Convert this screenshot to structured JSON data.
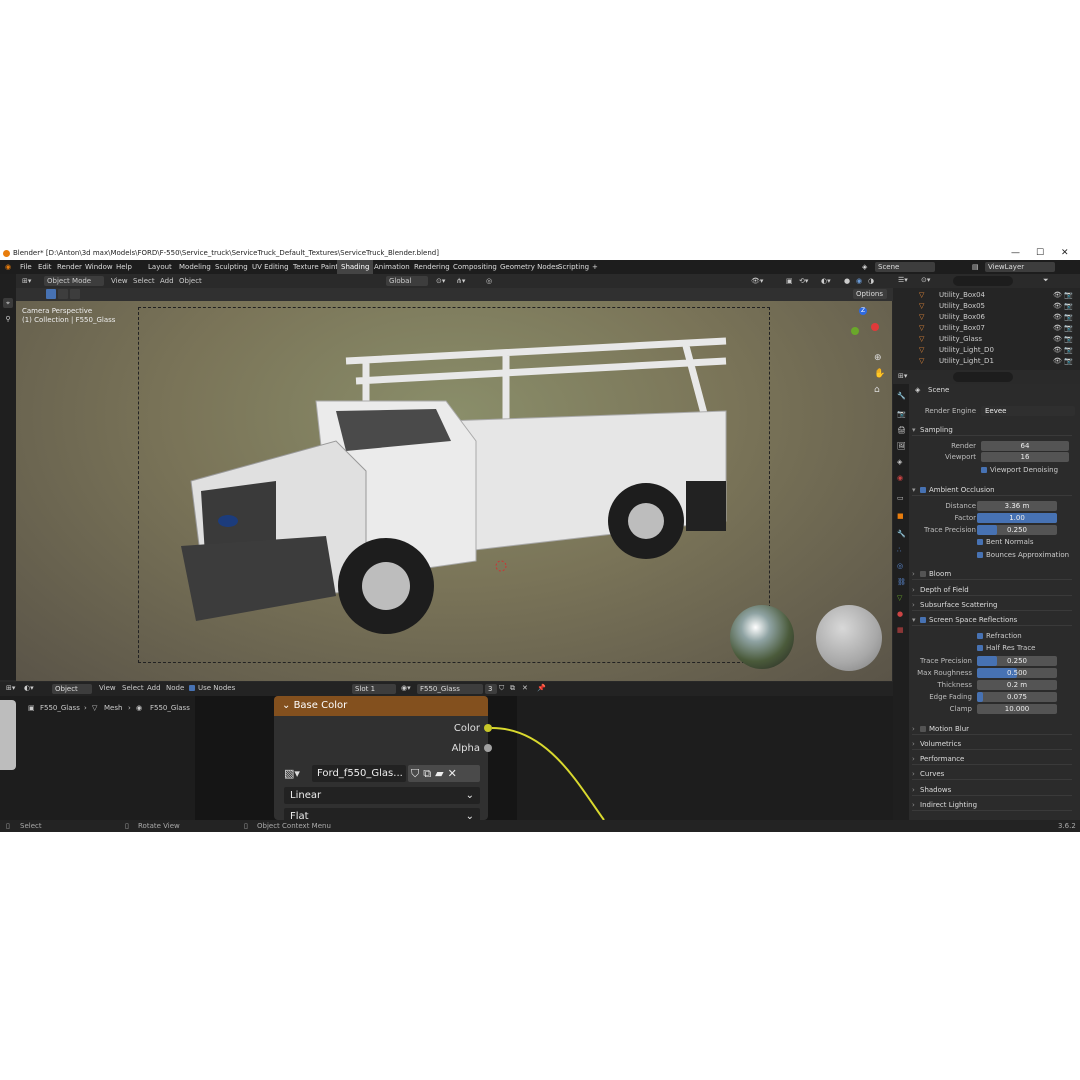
{
  "window": {
    "title": "Blender* [D:\\Anton\\3d max\\Models\\FORD\\F-550\\Service_truck\\ServiceTruck_Default_Textures\\ServiceTruck_Blender.blend]",
    "minimize": "—",
    "maximize": "☐",
    "close": "✕"
  },
  "menu": [
    "File",
    "Edit",
    "Render",
    "Window",
    "Help"
  ],
  "workspaces": [
    "Layout",
    "Modeling",
    "Sculpting",
    "UV Editing",
    "Texture Paint",
    "Shading",
    "Animation",
    "Rendering",
    "Compositing",
    "Geometry Nodes",
    "Scripting"
  ],
  "workspace_add": "+",
  "scene": {
    "label": "Scene",
    "viewlayer": "ViewLayer"
  },
  "viewport": {
    "mode": "Object Mode",
    "menus": [
      "View",
      "Select",
      "Add",
      "Object"
    ],
    "orientation": "Global",
    "options": "Options",
    "overlay_line1": "Camera Perspective",
    "overlay_line2": "(1) Collection | F550_Glass"
  },
  "outliner": {
    "items": [
      "Utility_Box04",
      "Utility_Box05",
      "Utility_Box06",
      "Utility_Box07",
      "Utility_Glass",
      "Utility_Light_D0",
      "Utility_Light_D1"
    ]
  },
  "properties": {
    "scene": "Scene",
    "render_engine_label": "Render Engine",
    "render_engine": "Eevee",
    "sampling": "Sampling",
    "render_label": "Render",
    "render_val": "64",
    "viewport_label": "Viewport",
    "viewport_val": "16",
    "viewport_denoising": "Viewport Denoising",
    "ao": "Ambient Occlusion",
    "distance_label": "Distance",
    "distance_val": "3.36 m",
    "factor_label": "Factor",
    "factor_val": "1.00",
    "factor_fill": 1.0,
    "trace_label": "Trace Precision",
    "trace_val": "0.250",
    "trace_fill": 0.25,
    "bent_normals": "Bent Normals",
    "bounces": "Bounces Approximation",
    "bloom": "Bloom",
    "dof": "Depth of Field",
    "sss": "Subsurface Scattering",
    "ssr": "Screen Space Reflections",
    "refraction": "Refraction",
    "half_res": "Half Res Trace",
    "ssr_trace_label": "Trace Precision",
    "ssr_trace_val": "0.250",
    "ssr_trace_fill": 0.25,
    "max_rough_label": "Max Roughness",
    "max_rough_val": "0.500",
    "max_rough_fill": 0.5,
    "thickness_label": "Thickness",
    "thickness_val": "0.2 m",
    "edge_label": "Edge Fading",
    "edge_val": "0.075",
    "edge_fill": 0.075,
    "clamp_label": "Clamp",
    "clamp_val": "10.000",
    "collapsed": [
      "Motion Blur",
      "Volumetrics",
      "Performance",
      "Curves",
      "Shadows",
      "Indirect Lighting"
    ]
  },
  "node_editor": {
    "object": "Object",
    "menus": [
      "View",
      "Select",
      "Add",
      "Node"
    ],
    "use_nodes": "Use Nodes",
    "slot": "Slot 1",
    "material": "F550_Glass",
    "users": "3",
    "breadcrumb": [
      "F550_Glass",
      "Mesh",
      "F550_Glass"
    ],
    "node": {
      "title": "Base Color",
      "out_color": "Color",
      "out_alpha": "Alpha",
      "image": "Ford_f550_Glas...",
      "interp": "Linear",
      "proj": "Flat"
    }
  },
  "status": {
    "select": "Select",
    "rotate": "Rotate View",
    "context": "Object Context Menu",
    "version": "3.6.2"
  },
  "colors": {
    "accent": "#4772b3",
    "node_header": "#83501e",
    "orange": "#e87d0d"
  }
}
